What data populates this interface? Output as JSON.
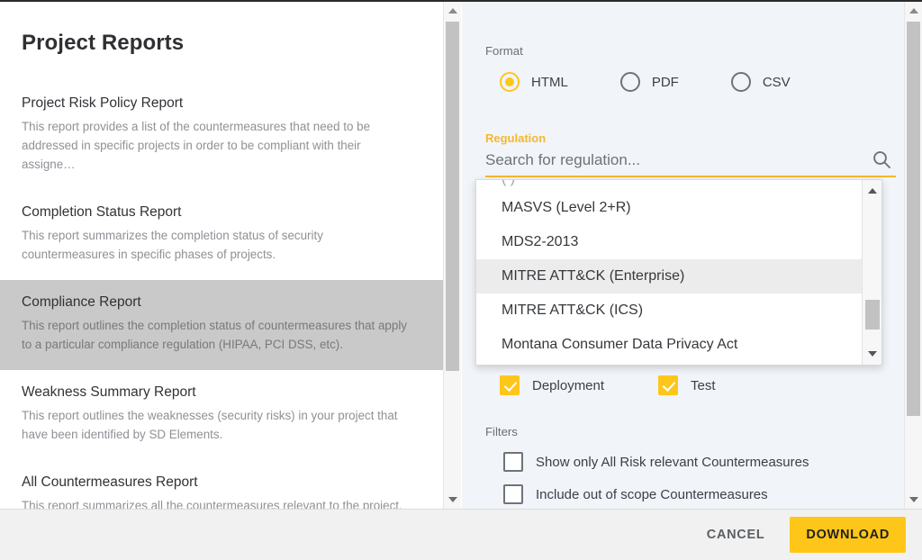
{
  "left_panel": {
    "title": "Project Reports",
    "reports": [
      {
        "name": "Project Risk Policy Report",
        "description": "This report provides a list of the countermeasures that need to be addressed in specific projects in order to be compliant with their assigne…",
        "selected": false
      },
      {
        "name": "Completion Status Report",
        "description": "This report summarizes the completion status of security countermeasures in specific phases of projects.",
        "selected": false
      },
      {
        "name": "Compliance Report",
        "description": "This report outlines the completion status of countermeasures that apply to a particular compliance regulation (HIPAA, PCI DSS, etc).",
        "selected": true
      },
      {
        "name": "Weakness Summary Report",
        "description": "This report outlines the weaknesses (security risks) in your project that have been identified by SD Elements.",
        "selected": false
      },
      {
        "name": "All Countermeasures Report",
        "description": "This report summarizes all the countermeasures relevant to the project.",
        "selected": false
      }
    ]
  },
  "right_panel": {
    "format": {
      "label": "Format",
      "options": [
        {
          "label": "HTML",
          "selected": true
        },
        {
          "label": "PDF",
          "selected": false
        },
        {
          "label": "CSV",
          "selected": false
        }
      ]
    },
    "regulation": {
      "label": "Regulation",
      "placeholder": "Search for regulation...",
      "value": "",
      "search_icon": "search-icon",
      "dropdown": {
        "items": [
          {
            "label": "MASVS (Level 2+R)",
            "highlighted": false
          },
          {
            "label": "MDS2-2013",
            "highlighted": false
          },
          {
            "label": "MITRE ATT&CK (Enterprise)",
            "highlighted": true
          },
          {
            "label": "MITRE ATT&CK (ICS)",
            "highlighted": false
          },
          {
            "label": "Montana Consumer Data Privacy Act",
            "highlighted": false
          }
        ]
      }
    },
    "phases": [
      {
        "label": "Deployment",
        "checked": true
      },
      {
        "label": "Test",
        "checked": true
      }
    ],
    "filters": {
      "label": "Filters",
      "items": [
        {
          "label": "Show only All Risk relevant Countermeasures",
          "checked": false
        },
        {
          "label": "Include out of scope Countermeasures",
          "checked": false
        }
      ]
    }
  },
  "footer": {
    "cancel_label": "CANCEL",
    "download_label": "DOWNLOAD"
  },
  "colors": {
    "accent": "#ffc61a",
    "accent_label": "#f5b82e",
    "selected_row": "#c9c9c9",
    "panel_bg": "#f1f4f9",
    "footer_bg": "#f1f1f1"
  }
}
